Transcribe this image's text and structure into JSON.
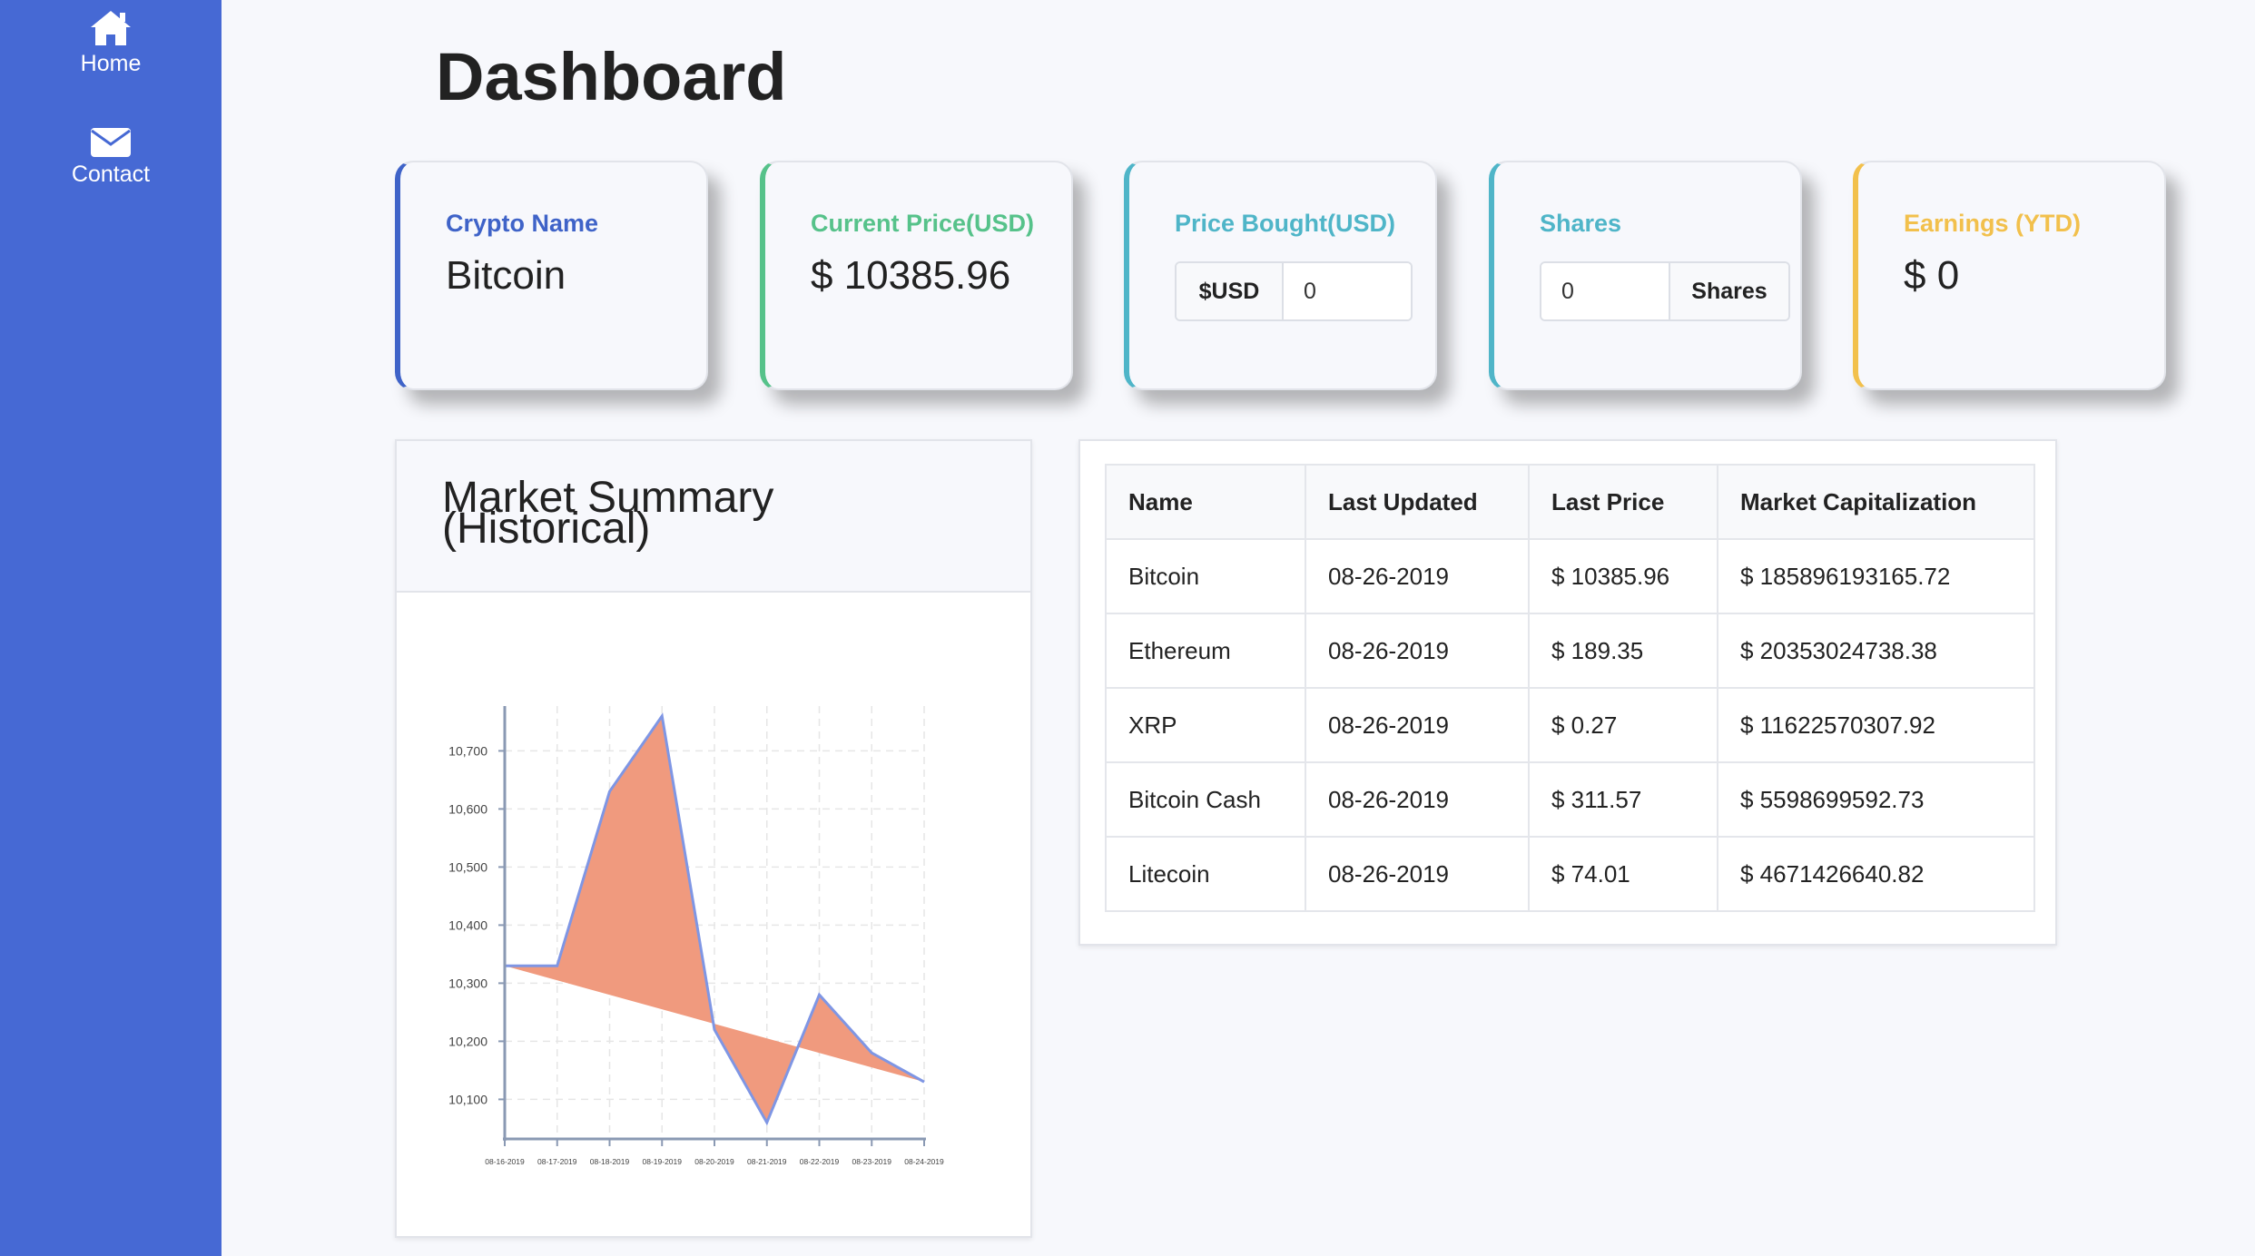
{
  "sidebar": {
    "items": [
      {
        "label": "Home",
        "icon": "home-icon"
      },
      {
        "label": "Contact",
        "icon": "envelope-icon"
      }
    ]
  },
  "page": {
    "title": "Dashboard"
  },
  "cards": {
    "crypto_name": {
      "label": "Crypto Name",
      "value": "Bitcoin",
      "color": "#3f63c8"
    },
    "current_price": {
      "label": "Current Price(USD)",
      "value": "$ 10385.96",
      "color": "#56c28a"
    },
    "price_bought": {
      "label": "Price Bought(USD)",
      "prefix": "$USD",
      "value": "0",
      "color": "#4fb5c8"
    },
    "shares": {
      "label": "Shares",
      "value": "0",
      "suffix": "Shares",
      "color": "#4fb5c8"
    },
    "earnings": {
      "label": "Earnings (YTD)",
      "value": "$ 0",
      "color": "#f2c04c"
    }
  },
  "market_summary": {
    "title": "Market Summary (Historical)"
  },
  "chart_data": {
    "type": "area",
    "x": [
      "08-16-2019",
      "08-17-2019",
      "08-18-2019",
      "08-19-2019",
      "08-20-2019",
      "08-21-2019",
      "08-22-2019",
      "08-23-2019",
      "08-24-2019"
    ],
    "values": [
      10330,
      10330,
      10630,
      10760,
      10220,
      10060,
      10280,
      10180,
      10130
    ],
    "yticks": [
      "10,100",
      "10,200",
      "10,300",
      "10,400",
      "10,500",
      "10,600",
      "10,700"
    ],
    "ylim": [
      10035,
      10760
    ],
    "grid": true,
    "fill_color": "#f09a7e",
    "line_color": "#7f96e4"
  },
  "table": {
    "headers": [
      "Name",
      "Last Updated",
      "Last Price",
      "Market Capitalization"
    ],
    "rows": [
      [
        "Bitcoin",
        "08-26-2019",
        "$ 10385.96",
        "$ 185896193165.72"
      ],
      [
        "Ethereum",
        "08-26-2019",
        "$ 189.35",
        "$ 20353024738.38"
      ],
      [
        "XRP",
        "08-26-2019",
        "$ 0.27",
        "$ 11622570307.92"
      ],
      [
        "Bitcoin Cash",
        "08-26-2019",
        "$ 311.57",
        "$ 5598699592.73"
      ],
      [
        "Litecoin",
        "08-26-2019",
        "$ 74.01",
        "$ 4671426640.82"
      ]
    ]
  }
}
